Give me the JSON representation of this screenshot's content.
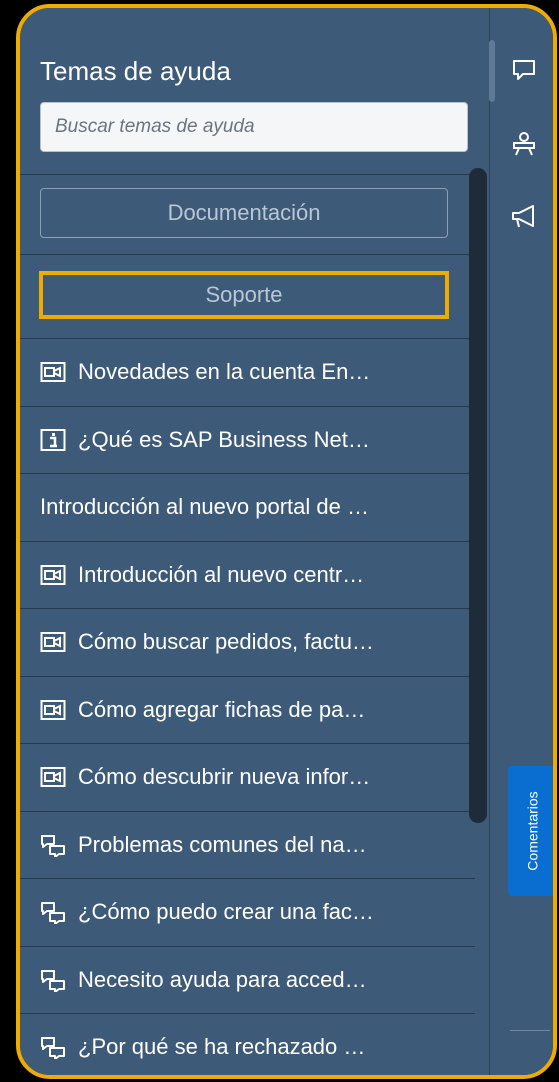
{
  "header": {
    "title": "Temas de ayuda",
    "search_placeholder": "Buscar temas de ayuda"
  },
  "buttons": {
    "documentation": "Documentación",
    "support": "Soporte"
  },
  "topics": [
    {
      "icon": "video-icon",
      "label": "Novedades en la cuenta En…"
    },
    {
      "icon": "info-icon",
      "label": "¿Qué es SAP Business Net…"
    },
    {
      "icon": "",
      "label": "Introducción al nuevo portal de …"
    },
    {
      "icon": "video-icon",
      "label": "Introducción al nuevo centr…"
    },
    {
      "icon": "video-icon",
      "label": "Cómo buscar pedidos, factu…"
    },
    {
      "icon": "video-icon",
      "label": "Cómo agregar fichas de pa…"
    },
    {
      "icon": "video-icon",
      "label": "Cómo descubrir nueva infor…"
    },
    {
      "icon": "discussion-icon",
      "label": "Problemas comunes del na…"
    },
    {
      "icon": "discussion-icon",
      "label": "¿Cómo puedo crear una fac…"
    },
    {
      "icon": "discussion-icon",
      "label": "Necesito ayuda para acced…"
    },
    {
      "icon": "discussion-icon",
      "label": "¿Por qué se ha rechazado …"
    }
  ],
  "right_bar": {
    "icons": [
      "chat-icon",
      "presentation-icon",
      "megaphone-icon"
    ],
    "feedback_label": "Comentarios"
  },
  "colors": {
    "panel": "#3d5a78",
    "highlight": "#f0ab00",
    "feedback": "#0a6ed1"
  }
}
